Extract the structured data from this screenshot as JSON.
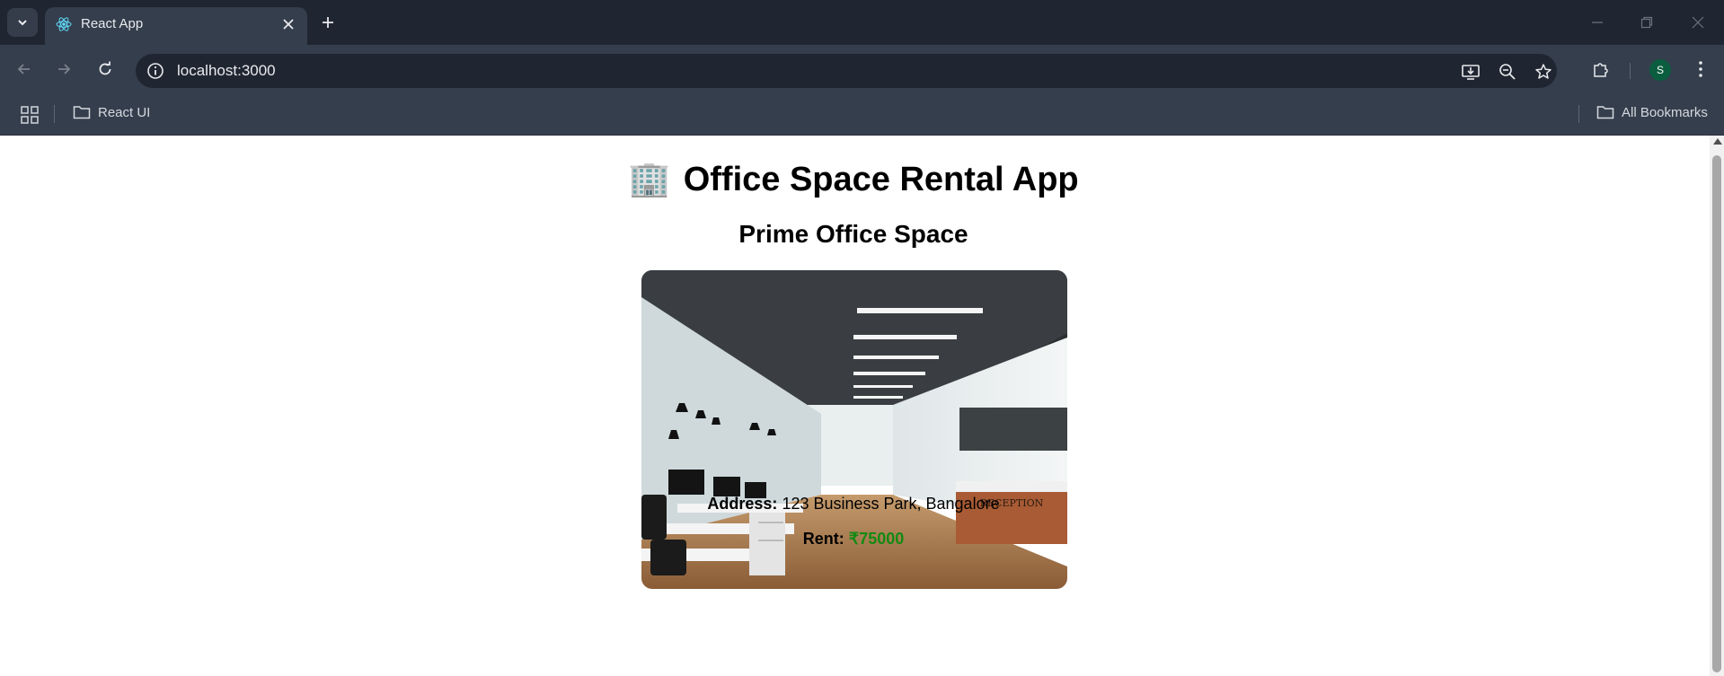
{
  "browser": {
    "tab_title": "React App",
    "url": "localhost:3000",
    "profile_initial": "S",
    "bookmarks": [
      {
        "label": "React UI",
        "icon": "folder-icon"
      }
    ],
    "all_bookmarks_label": "All Bookmarks"
  },
  "page": {
    "app_title_emoji": "🏢",
    "app_title": "Office Space Rental App",
    "listing_title": "Prime Office Space",
    "photo_alt": "Office interior",
    "reception_sign": "RECEPTION",
    "address_label": "Address:",
    "address_value": "123 Business Park, Bangalore",
    "rent_label": "Rent:",
    "rent_value": "₹75000"
  },
  "colors": {
    "rent_value": "#128a12",
    "chrome_dark": "#202631",
    "chrome_mid": "#353e4d"
  }
}
